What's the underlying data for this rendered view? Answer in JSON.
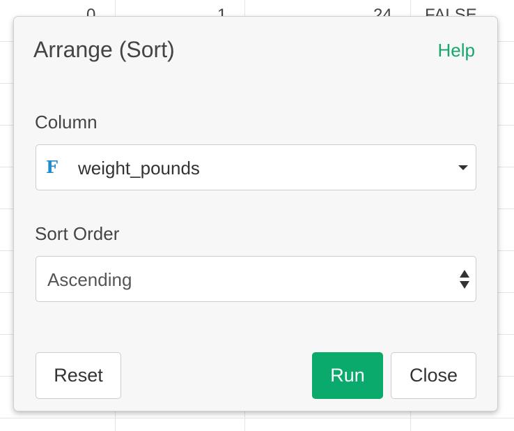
{
  "background_table": {
    "row1": [
      "0",
      "1",
      "24",
      "FALSE"
    ]
  },
  "dialog": {
    "title": "Arrange (Sort)",
    "help_label": "Help",
    "column_field": {
      "label": "Column",
      "type_icon": "F",
      "value": "weight_pounds"
    },
    "sort_order_field": {
      "label": "Sort Order",
      "value": "Ascending"
    },
    "buttons": {
      "reset": "Reset",
      "run": "Run",
      "close": "Close"
    }
  },
  "colors": {
    "accent_green": "#17a76d",
    "run_button": "#0aaa6c",
    "type_icon_blue": "#1e8ccc",
    "dialog_background": "#f7f7f7"
  }
}
